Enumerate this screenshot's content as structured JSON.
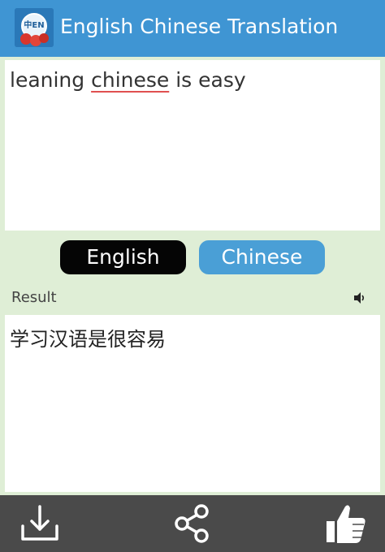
{
  "header": {
    "title": "English Chinese Translation",
    "icon": "app-logo-icon",
    "bg_color": "#3f95d3"
  },
  "input": {
    "text_before": "leaning ",
    "text_misspelled": "chinese",
    "text_after": " is easy"
  },
  "languages": {
    "source": "English",
    "target": "Chinese",
    "source_color": "#050505",
    "target_color": "#4a9fd6"
  },
  "result": {
    "label": "Result",
    "text": "学习汉语是很容易",
    "speaker_icon": "speaker-icon"
  },
  "bottom_bar": {
    "icons": [
      "download-icon",
      "share-icon",
      "thumbs-up-icon"
    ],
    "bg_color": "#4a4a4a"
  }
}
